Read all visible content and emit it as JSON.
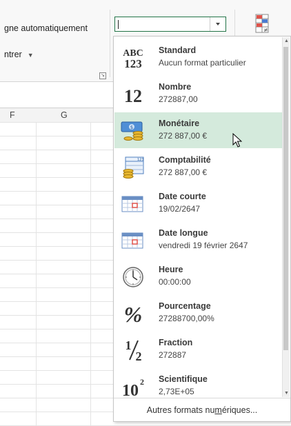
{
  "ribbon": {
    "wrap_text_label": "gne automatiquement",
    "merge_label": "ntrer",
    "format_combo_value": ""
  },
  "grid": {
    "columns": [
      "F",
      "G"
    ]
  },
  "number_format_menu": {
    "items": [
      {
        "name": "Standard",
        "example": "Aucun format particulier",
        "icon": "abc-123-icon"
      },
      {
        "name": "Nombre",
        "example": "272887,00",
        "icon": "number-12-icon"
      },
      {
        "name": "Monétaire",
        "example": "272 887,00 €",
        "icon": "currency-icon",
        "highlighted": true
      },
      {
        "name": "Comptabilité",
        "example": " 272 887,00 €",
        "icon": "accounting-icon"
      },
      {
        "name": "Date courte",
        "example": "19/02/2647",
        "icon": "calendar-short-icon"
      },
      {
        "name": "Date longue",
        "example": "vendredi 19 février 2647",
        "icon": "calendar-long-icon"
      },
      {
        "name": "Heure",
        "example": "00:00:00",
        "icon": "clock-icon"
      },
      {
        "name": "Pourcentage",
        "example": "27288700,00%",
        "icon": "percent-icon"
      },
      {
        "name": "Fraction",
        "example": "272887",
        "icon": "fraction-icon"
      },
      {
        "name": "Scientifique",
        "example": "2,73E+05",
        "icon": "scientific-icon"
      }
    ],
    "footer_pre": "Autres formats nu",
    "footer_ul": "m",
    "footer_post": "ériques...",
    "icon_text": {
      "abc": "ABC",
      "num123": "123",
      "twelve": "12",
      "cash": "$",
      "ledger": "123",
      "percent": "%",
      "frac_num": "1",
      "frac_den": "2",
      "ten": "10",
      "exp": "2"
    }
  },
  "colors": {
    "accent": "#217346",
    "highlight": "#d4eadc"
  }
}
